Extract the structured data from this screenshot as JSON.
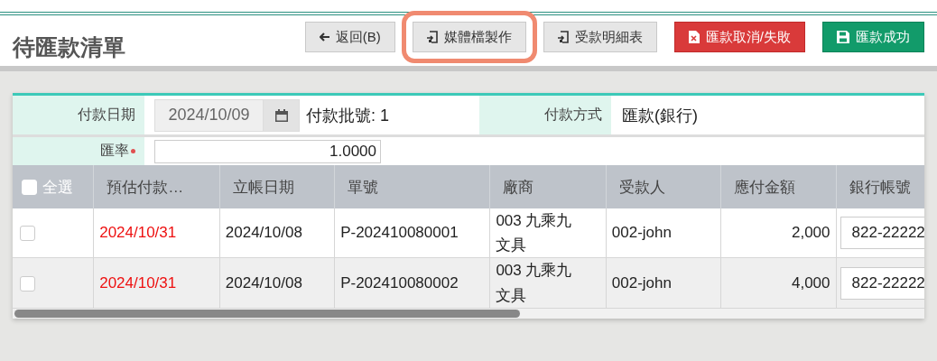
{
  "page": {
    "title": "待匯款清單"
  },
  "buttons": [
    {
      "label": "返回(B)",
      "kind": "back",
      "highlighted": false
    },
    {
      "label": "媒體檔製作",
      "kind": "media",
      "highlighted": true
    },
    {
      "label": "受款明細表",
      "kind": "detail",
      "highlighted": false
    },
    {
      "label": "匯款取消/失敗",
      "kind": "cancel",
      "highlighted": false
    },
    {
      "label": "匯款成功",
      "kind": "success",
      "highlighted": false
    }
  ],
  "form": {
    "payment_date_label": "付款日期",
    "payment_date": "2024/10/09",
    "batch_no": "付款批號: 1",
    "method_label": "付款方式",
    "method": "匯款(銀行)",
    "rate_label": "匯率",
    "rate_required": true,
    "rate": "1.0000"
  },
  "table": {
    "select_all": {
      "label": "全選",
      "checked": false
    },
    "columns": [
      "預估付款…",
      "立帳日期",
      "單號",
      "廠商",
      "受款人",
      "應付金額",
      "銀行帳號"
    ],
    "rows": [
      {
        "checked": false,
        "due_date": "2024/10/31",
        "overdue": true,
        "date": "2024/10/08",
        "number": "P-202410080001",
        "vendor": "003 九乘九文具",
        "payee": "002-john",
        "amount": "2,000",
        "account": "822-22222"
      },
      {
        "checked": false,
        "due_date": "2024/10/31",
        "overdue": true,
        "date": "2024/10/08",
        "number": "P-202410080002",
        "vendor": "003 九乘九文具",
        "payee": "002-john",
        "amount": "4,000",
        "account": "822-22222"
      }
    ]
  }
}
